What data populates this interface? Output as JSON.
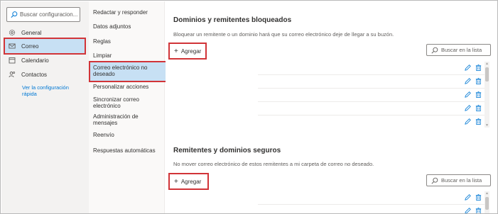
{
  "search": {
    "placeholder": "Buscar configuracion..."
  },
  "left_nav": {
    "items": [
      {
        "label": "General",
        "icon": "gear-icon"
      },
      {
        "label": "Correo",
        "icon": "mail-icon",
        "selected": true
      },
      {
        "label": "Calendario",
        "icon": "calendar-icon"
      },
      {
        "label": "Contactos",
        "icon": "contacts-icon"
      }
    ],
    "quick_settings": "Ver la configuración rápida"
  },
  "sub_nav": {
    "items": [
      "Redactar y responder",
      "Datos adjuntos",
      "Reglas",
      "Limpiar",
      "Correo electrónico no deseado",
      "Personalizar acciones",
      "Sincronizar correo electrónico",
      "Administración de mensajes",
      "Reenvío",
      "Respuestas automáticas"
    ],
    "selected": "Correo electrónico no deseado"
  },
  "blocked": {
    "title": "Dominios y remitentes bloqueados",
    "description": "Bloquear un remitente o un dominio hará que su correo electrónico deje de llegar a su buzón.",
    "add_label": "Agregar",
    "search_label": "Buscar en la lista",
    "rows": [
      "",
      "",
      "",
      "",
      ""
    ]
  },
  "safe": {
    "title": "Remitentes y dominios seguros",
    "description": "No mover correo electrónico de estos remitentes a mi carpeta de correo no deseado.",
    "add_label": "Agregar",
    "search_label": "Buscar en la lista",
    "rows": [
      "",
      ""
    ]
  },
  "colors": {
    "selected_bg": "#c7e0f4",
    "highlight_border": "#d13438",
    "link": "#0078d4",
    "icon_blue": "#0078d4"
  }
}
